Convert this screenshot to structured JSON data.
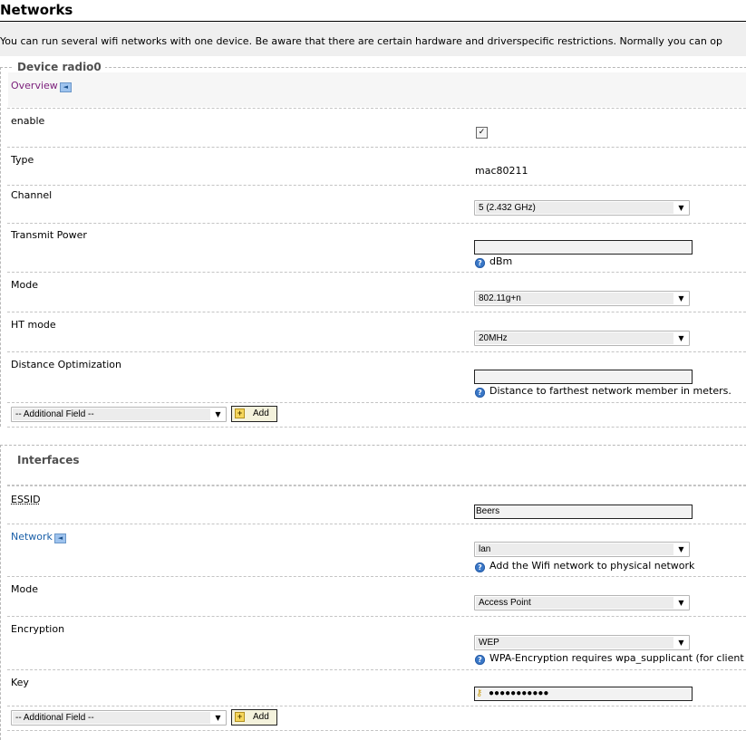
{
  "page": {
    "title": "Networks",
    "description": "You can run several wifi networks with one device. Be aware that there are certain hardware and driverspecific restrictions. Normally you can op"
  },
  "device": {
    "legend": "Device radio0",
    "overview_label": "Overview",
    "fields": {
      "enable": {
        "label": "enable",
        "checked": true,
        "check_glyph": "✓"
      },
      "type": {
        "label": "Type",
        "value": "mac80211"
      },
      "channel": {
        "label": "Channel",
        "value": "5 (2.432 GHz)"
      },
      "transmit_power": {
        "label": "Transmit Power",
        "value": "",
        "hint": "dBm"
      },
      "mode": {
        "label": "Mode",
        "value": "802.11g+n"
      },
      "ht_mode": {
        "label": "HT mode",
        "value": "20MHz"
      },
      "distance": {
        "label": "Distance Optimization",
        "value": "",
        "hint": "Distance to farthest network member in meters."
      }
    },
    "additional_field": "-- Additional Field --",
    "add_label": "Add"
  },
  "interfaces": {
    "legend": "Interfaces",
    "fields": {
      "essid": {
        "label": "ESSID",
        "value": "Beers"
      },
      "network": {
        "label": "Network",
        "value": "lan",
        "hint": "Add the Wifi network to physical network"
      },
      "mode": {
        "label": "Mode",
        "value": "Access Point"
      },
      "encryption": {
        "label": "Encryption",
        "value": "WEP",
        "hint": "WPA-Encryption requires wpa_supplicant (for client"
      },
      "key": {
        "label": "Key",
        "masked_value": "●●●●●●●●●●●"
      }
    },
    "additional_field": "-- Additional Field --",
    "add_label": "Add"
  },
  "icons": {
    "help": "help-icon",
    "back": "back-arrow-icon",
    "key": "key-icon",
    "add": "add-icon",
    "dropdown": "chevron-down-icon"
  },
  "colors": {
    "link": "#1a5fa8",
    "visited_link": "#7a1d7a",
    "help_icon": "#3a78c8",
    "description_band": "#efefef"
  }
}
